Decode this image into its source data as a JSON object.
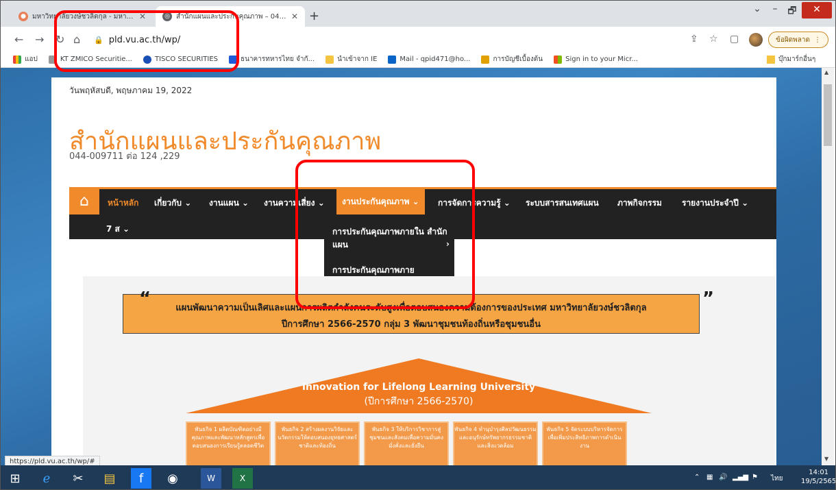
{
  "browser": {
    "tabs": [
      {
        "title": "มหาวิทยาลัยวงษ์ชวลิตกุล - มหาวิทยาลัย",
        "active": false
      },
      {
        "title": "สำนักแผนและประกันคุณภาพ – 044-0",
        "active": true
      }
    ],
    "new_tab": "+",
    "window_controls": {
      "dropdown": "⌄",
      "minimize": "–",
      "maximize": "🗗",
      "close": "✕"
    },
    "url": "pld.vu.ac.th/wp/",
    "error_button": "ข้อผิดพลาด",
    "status_url": "https://pld.vu.ac.th/wp/#"
  },
  "bookmarks": {
    "apps": "แอป",
    "items": [
      {
        "label": "KT ZMICO Securitie...",
        "color": "#888888"
      },
      {
        "label": "TISCO SECURITIES",
        "color": "#1a4fb5"
      },
      {
        "label": "ธนาคารทหารไทย จำกั...",
        "color": "#1e5bd8"
      },
      {
        "label": "นำเข้าจาก IE",
        "color": "#f5c542"
      },
      {
        "label": "Mail - qpid471@ho...",
        "color": "#0a64c8"
      },
      {
        "label": "การบัญชีเบื้องต้น",
        "color": "#e0a000"
      },
      {
        "label": "Sign in to your Micr...",
        "color": "#f25022"
      }
    ],
    "other": "บุ๊กมาร์กอื่นๆ"
  },
  "page": {
    "date": "วันพฤหัสบดี, พฤษภาคม 19, 2022",
    "site_title": "สำนักแผนและประกันคุณภาพ",
    "phone": "044-009711 ต่อ 124 ,229",
    "nav": {
      "home": "หน้าหลัก",
      "about": "เกี่ยวกับ ⌄",
      "plan": "งานแผน ⌄",
      "risk": "งานความเสี่ยง ⌄",
      "qa": "งานประกันคุณภาพ ⌄",
      "km": "การจัดการความรู้ ⌄",
      "info": "ระบบสารสนเทศแผน",
      "activities": "ภาพกิจกรรม",
      "annual": "รายงานประจำปี ⌄",
      "seven_s": "7 ส ⌄"
    },
    "dropdown": {
      "item1": "การประกันคุณภาพภายใน สำนักแผน",
      "item1_arrow": "›",
      "item2": "การประกันคุณภาพภาย มหาวิทยาลัยวงษ์ชวลิตกุล"
    },
    "banner": {
      "quote_open": "“",
      "quote_close": "”",
      "line1": "แผนพัฒนาความเป็นเลิศและแผนการผลิตกำลังคนระดับสูงเพื่อตอบสนองความต้องการของประเทศ มหาวิทยาลัยวงษ์ชวลิตกุล",
      "line2": "ปีการศึกษา 2566-2570 กลุ่ม 3 พัฒนาชุมชนท้องถิ่นหรือชุมชนอื่น",
      "roof_title": "Innovation for Lifelong Learning University",
      "roof_sub": "(ปีการศึกษา 2566-2570)",
      "pillars": [
        "พันธกิจ 1\nผลิตบัณฑิตอย่างมีคุณภาพและพัฒนาหลักสูตรเพื่อตอบสนองการเรียนรู้ตลอดชีวิต",
        "พันธกิจ 2\nสร้างผลงานวิจัยและนวัตกรรมให้ตอบสนองยุทธศาสตร์ชาติและท้องถิ่น",
        "พันธกิจ 3\nให้บริการวิชาการสู่ชุมชนและสังคมเพื่อความมั่นคง มั่งคั่งและยั่งยืน",
        "พันธกิจ 4\nทำนุบำรุงศิลปวัฒนธรรมและอนุรักษ์ทรัพยากรธรรมชาติและสิ่งแวดล้อม",
        "พันธกิจ 5\nจัดระบบบริหารจัดการเพื่อเพิ่มประสิทธิภาพการดำเนินงาน"
      ]
    }
  },
  "taskbar": {
    "lang": "ไทย",
    "time": "14:01",
    "date": "19/5/2565"
  },
  "colors": {
    "accent": "#f08a2a",
    "nav_bg": "#222222",
    "highlight": "#ff0000"
  }
}
